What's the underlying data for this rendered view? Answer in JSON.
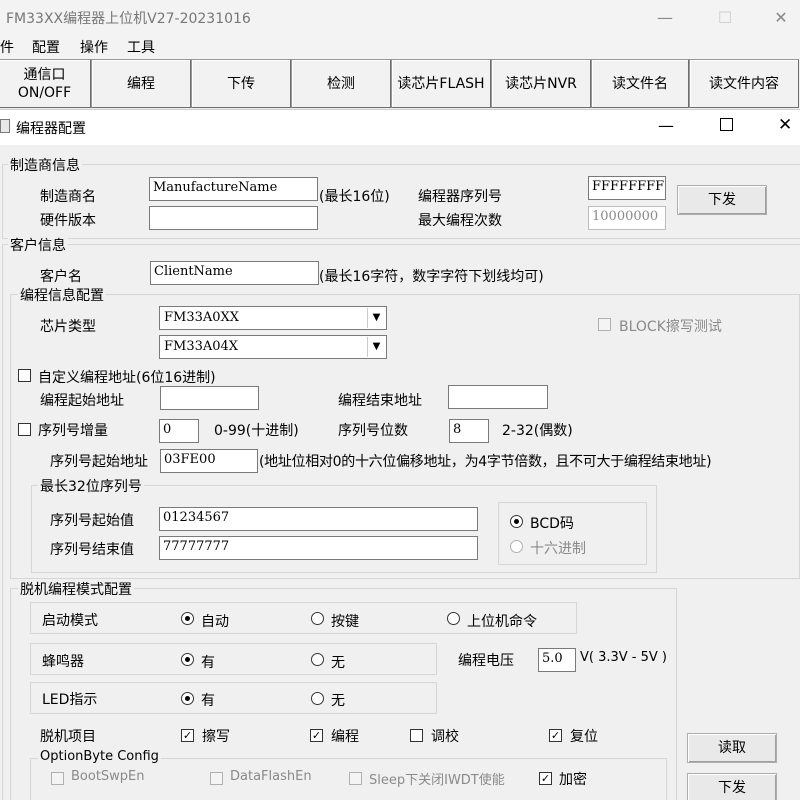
{
  "main_window": {
    "title": "FM33XX编程器上位机V27-20231016",
    "menu": [
      "件",
      "配置",
      "操作",
      "工具"
    ]
  },
  "toolbar": {
    "buttons": [
      "通信口",
      "ON/OFF",
      "编程",
      "下传",
      "检测",
      "读芯片FLASH",
      "读芯片NVR",
      "读文件名",
      "读文件内容"
    ]
  },
  "dialog": {
    "title": "编程器配置"
  },
  "manufacturer": {
    "group": "制造商信息",
    "name_label": "制造商名",
    "name_value": "ManufactureName",
    "name_hint": "(最长16位)",
    "hw_label": "硬件版本",
    "hw_value": "",
    "serial_label": "编程器序列号",
    "serial_value": "FFFFFFFF",
    "maxcount_label": "最大编程次数",
    "maxcount_value": "10000000",
    "send_button": "下发"
  },
  "customer": {
    "group": "客户信息",
    "name_label": "客户名",
    "name_value": "ClientName",
    "name_hint": "(最长16字符，数字字符下划线均可)"
  },
  "program_info": {
    "group": "编程信息配置",
    "chip_label": "芯片类型",
    "chip_value1": "FM33A0XX",
    "chip_value2": "FM33A04X",
    "block_test_label": "BLOCK擦写测试",
    "custom_addr_label": "自定义编程地址(6位16进制)",
    "start_addr_label": "编程起始地址",
    "start_addr_value": "",
    "end_addr_label": "编程结束地址",
    "end_addr_value": "",
    "serial_inc_label": "序列号增量",
    "serial_inc_value": "0",
    "serial_inc_hint": "0-99(十进制)",
    "serial_digits_label": "序列号位数",
    "serial_digits_value": "8",
    "serial_digits_hint": "2-32(偶数)",
    "serial_addr_label": "序列号起始地址",
    "serial_addr_value": "03FE00",
    "serial_addr_hint": "(地址位相对0的十六位偏移地址，为4字节倍数，且不可大于编程结束地址)"
  },
  "serial32": {
    "group": "最长32位序列号",
    "start_label": "序列号起始值",
    "start_value": "01234567",
    "end_label": "序列号结束值",
    "end_value": "77777777",
    "bcd_label": "BCD码",
    "hex_label": "十六进制"
  },
  "offline": {
    "group": "脱机编程模式配置",
    "start_mode_label": "启动模式",
    "start_mode_options": [
      "自动",
      "按键",
      "上位机命令"
    ],
    "buzzer_label": "蜂鸣器",
    "buzzer_options": [
      "有",
      "无"
    ],
    "voltage_label": "编程电压",
    "voltage_value": "5.0",
    "voltage_hint": "V( 3.3V - 5V )",
    "led_label": "LED指示",
    "led_options": [
      "有",
      "无"
    ],
    "items_label": "脱机项目",
    "items": [
      "擦写",
      "编程",
      "调校",
      "复位"
    ],
    "read_button": "读取",
    "send_button": "下发"
  },
  "optionbyte": {
    "group": "OptionByte Config",
    "items": [
      "BootSwpEn",
      "DataFlashEn",
      "Sleep下关闭IWDT使能",
      "加密"
    ]
  }
}
